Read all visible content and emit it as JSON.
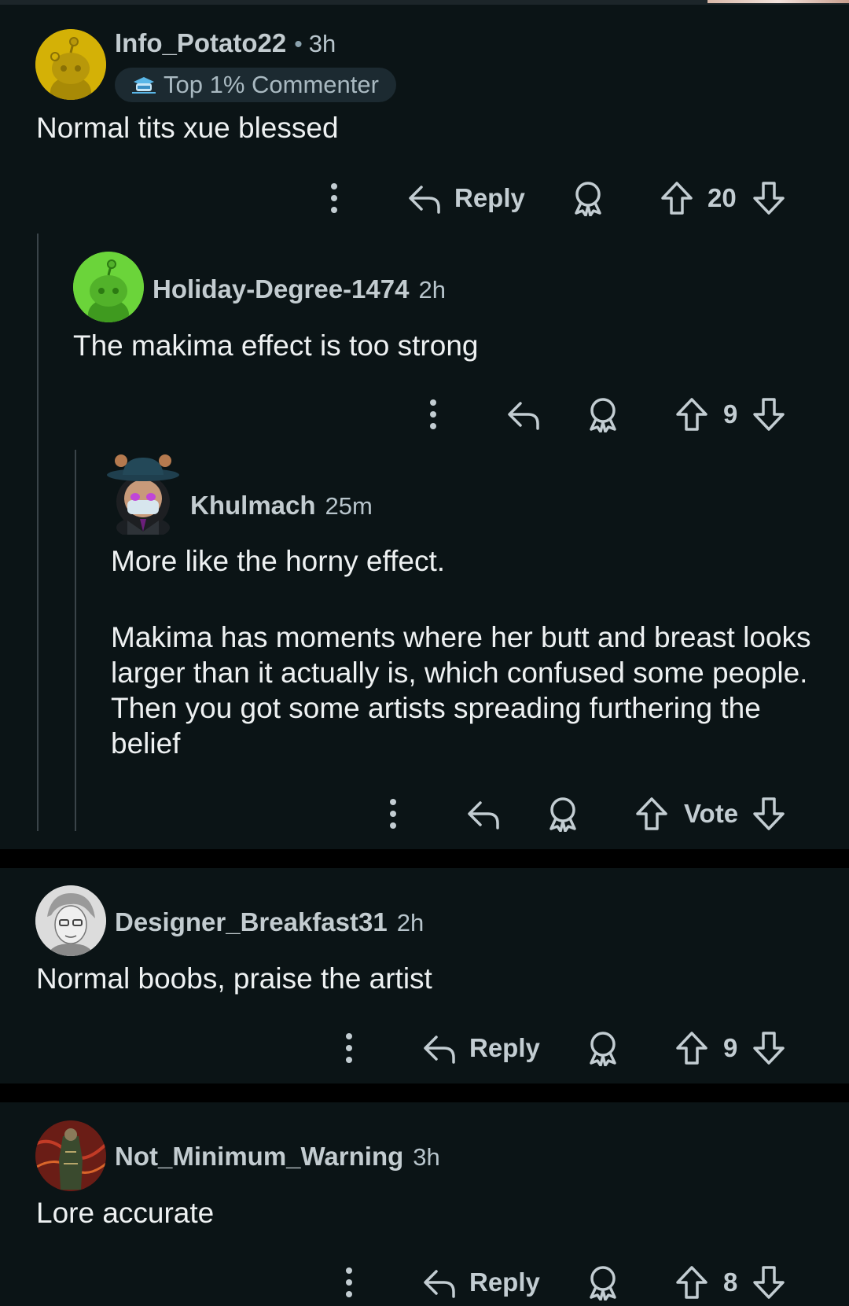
{
  "comments": [
    {
      "username": "Info_Potato22",
      "separator": "•",
      "time": "3h",
      "badge": "Top 1% Commenter",
      "body": [
        "Normal tits xue blessed"
      ],
      "reply_label": "Reply",
      "votes": "20"
    },
    {
      "username": "Holiday-Degree-1474",
      "time": "2h",
      "body": [
        "The makima effect is too strong"
      ],
      "reply_label": "",
      "votes": "9"
    },
    {
      "username": "Khulmach",
      "time": "25m",
      "body": [
        "More like the horny effect.",
        "Makima has moments where her butt and breast looks larger than it actually is, which confused some people. Then you got some artists spreading furthering the belief"
      ],
      "reply_label": "",
      "votes": "Vote"
    },
    {
      "username": "Designer_Breakfast31",
      "time": "2h",
      "body": [
        "Normal boobs, praise the artist"
      ],
      "reply_label": "Reply",
      "votes": "9"
    },
    {
      "username": "Not_Minimum_Warning",
      "time": "3h",
      "body": [
        "Lore accurate"
      ],
      "reply_label": "Reply",
      "votes": "8"
    }
  ],
  "icons": {
    "more": "more-vertical-icon",
    "reply": "reply-arrow-icon",
    "award": "award-icon",
    "upvote": "upvote-arrow-icon",
    "downvote": "downvote-arrow-icon"
  },
  "colors": {
    "background": "#0b1416",
    "separator": "#000000",
    "text": "#eef1f2",
    "username": "#c3ccd0",
    "badge_bg": "#1c2a31",
    "avatar_1": "#d4b106",
    "avatar_2": "#6bd43a"
  }
}
